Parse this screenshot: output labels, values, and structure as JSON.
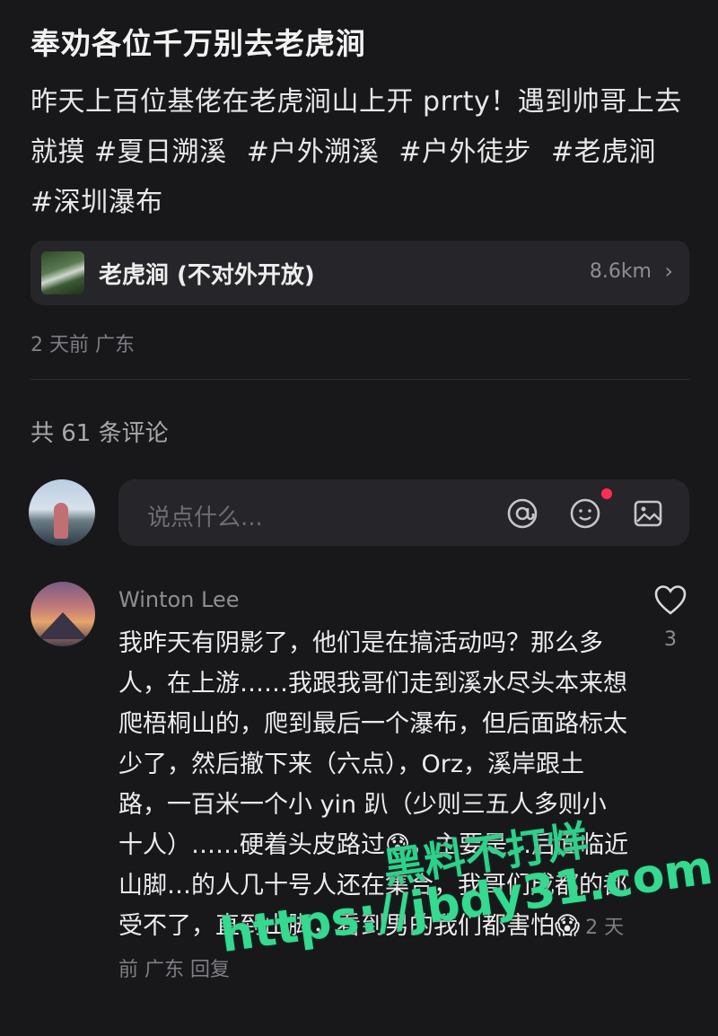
{
  "post": {
    "title": "奉劝各位千万别去老虎涧",
    "body": "昨天上百位基佬在老虎涧山上开 prrty！遇到帅哥上去就摸 ",
    "tags": [
      "#夏日溯溪",
      "#户外溯溪",
      "#户外徒步",
      "#老虎涧",
      "#深圳瀑布"
    ],
    "meta": "2 天前 广东"
  },
  "location": {
    "name": "老虎涧 (不对外开放)",
    "distance": "8.6km",
    "chevron": "›",
    "thumb_icon": "waterfall-thumbnail"
  },
  "comments_header": "共 61 条评论",
  "input": {
    "placeholder": "说点什么...",
    "icons": [
      "at-icon",
      "emoji-icon",
      "image-icon"
    ],
    "notification_dot_color": "#ff2d55"
  },
  "comment": {
    "author": "Winton Lee",
    "text": "我昨天有阴影了，他们是在搞活动吗？那么多人，在上游……我跟我哥们走到溪水尽头本来想爬梧桐山的，爬到最后一个瀑布，但后面路标太少了，然后撤下来（六点），Orz，溪岸跟土路，一百米一个小 yin 趴（少则三五人多则小十人）……硬着头皮路过😰，主要是…后面临近山脚…的人几十号人还在集合，我哥们成都的都受不了，直到山脚，看到男的我们都害怕😱",
    "meta": "2 天前 广东 回复",
    "like_count": "3"
  },
  "watermark": {
    "line1": "黑料不打烊",
    "line2": "https://jbdy31.com"
  },
  "colors": {
    "background": "#18181b",
    "card": "#26262a",
    "watermark": "#35d98f"
  }
}
